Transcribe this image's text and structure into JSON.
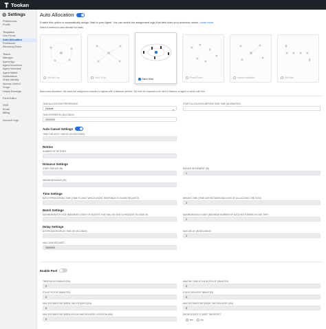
{
  "app": {
    "name": "Tookan"
  },
  "sidebar": {
    "header": "Settings",
    "items": [
      {
        "label": "Preferences"
      },
      {
        "label": "Profile"
      },
      {
        "label": "Templates"
      },
      {
        "label": "Geo Fence"
      },
      {
        "label": "Auto Allocation",
        "active": true
      },
      {
        "label": "Freelancer"
      },
      {
        "label": "Recurring Rules"
      },
      {
        "label": "Teams"
      },
      {
        "label": "Manager"
      },
      {
        "label": "Agent App"
      },
      {
        "label": "Agent Incentives"
      },
      {
        "label": "Agent Schedule"
      },
      {
        "label": "Agent Wallet"
      },
      {
        "label": "Notifications"
      },
      {
        "label": "Stripe Identity"
      },
      {
        "label": "Access Control"
      },
      {
        "label": "Surge"
      },
      {
        "label": "Hourly Earnings"
      },
      {
        "label": "Form Editor"
      },
      {
        "label": "SMS"
      },
      {
        "label": "Email"
      },
      {
        "label": "Billing"
      },
      {
        "label": "Account Logs"
      }
    ]
  },
  "main": {
    "title": "Auto Allocation",
    "enabled": true,
    "description": "Enable this option to automatically assign Task to your Agent. You can select the assignment logic that best suits your business needs.",
    "learn_more": "Learn more",
    "select_method": "Select a method to auto allocate the tasks",
    "methods": [
      {
        "label": "One By One"
      },
      {
        "label": "Send To All"
      },
      {
        "label": "Batch Wise",
        "selected": true
      },
      {
        "label": "Round Robin"
      },
      {
        "label": "Nearest Available"
      },
      {
        "label": "Fifo Wise"
      }
    ],
    "long_description": "Batch-wise allocation, the tasks are assigned in batches to agents with a distance defined. Set time for requests to be sent in batches of agent of which with this ..."
  },
  "form": {
    "task_allocation_label": "Task Allocation Preference",
    "task_allocation_value": "Default",
    "start_allocation_label": "Start Allocation Before Task Time (In Minutes)",
    "start_allocation_value": "",
    "task_expires_label": "Task Expires In (Seconds)",
    "task_expires_value": "3000000",
    "auto_cancel": {
      "label": "Auto Cancel Settings",
      "enabled": true
    },
    "auto_cancel_time_label": "Time For Auto Cancel (In Seconds)",
    "retries": {
      "title": "Retries",
      "label": "Number of Retries",
      "value": ""
    },
    "distance": {
      "title": "Distance Settings",
      "start_radius_label": "Start Radius (In)",
      "start_radius_value": "",
      "radius_increment_label": "Radius Increment (In)",
      "radius_increment_value": "1",
      "max_radius_label": "Maximum Radius (In)",
      "max_radius_value": ""
    },
    "time": {
      "title": "Time Settings",
      "wait_label": "Batch Processing Time (Time To Wait Which Agent Responds To A New Request)",
      "wait_value": "",
      "breaks_label": "Breaks Time (Time Gap Between Batches Of Allocating The Task)",
      "breaks_value": "3"
    },
    "batch": {
      "title": "Batch Settings",
      "max_batch_label": "Maximum Batch Size (Maximum Count Of Agents That Will Be Sent A Request In A Batch)",
      "max_batch_value": "",
      "max_limit_label": "Maximum Batch Limit (Maximum Number Of Batches Formed In One Trip)",
      "max_limit_value": "2"
    },
    "delay": {
      "title": "Delay Settings",
      "notification_label": "Notification Delay Time (In Seconds)",
      "notification_value": "",
      "max_delay_label": "Max Delay (In Seconds)",
      "max_delay_value": "3",
      "max_task_label": "Max Task Request",
      "max_task_value": "3000000"
    },
    "pool": {
      "title": "Enable Pool",
      "enabled": false,
      "fields": [
        {
          "label": "Threshold Radius (km)",
          "value": "5"
        },
        {
          "label": "Waiting Time At Each Pickup (Minutes)",
          "value": "5"
        },
        {
          "label": "ETA At Pickup (Minutes)",
          "value": "5"
        },
        {
          "label": "ETA At Delivery (Minutes)",
          "value": "5"
        },
        {
          "label": "Max Distance Between Two Pickups (km)",
          "value": "5"
        },
        {
          "label": "Max Distance Between Two Delivery (km)",
          "value": "5"
        },
        {
          "label": "Max Distance Between Pickup And Delivery Location (km)",
          "value": "5"
        }
      ],
      "short_route_label": "Show Route To Meet Shortest",
      "options": [
        "Yes",
        "No"
      ]
    }
  },
  "colors": {
    "accent": "#1e6ee8",
    "topbar": "#1f2329",
    "sidebar_bg": "#f1f2f4"
  }
}
